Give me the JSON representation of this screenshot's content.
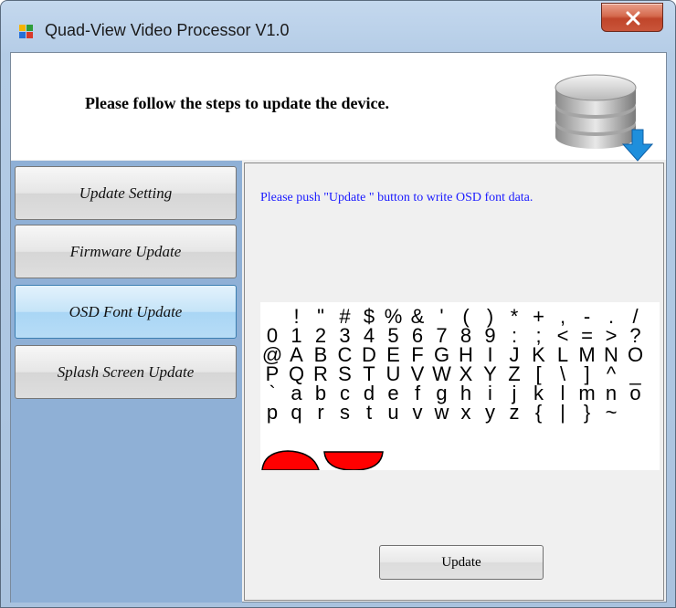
{
  "window": {
    "title": "Quad-View Video Processor V1.0"
  },
  "header": {
    "message": "Please follow the steps to update the device."
  },
  "sidebar": {
    "items": [
      {
        "label": "Update Setting",
        "active": false
      },
      {
        "label": "Firmware Update",
        "active": false
      },
      {
        "label": "OSD Font Update",
        "active": true
      },
      {
        "label": "Splash Screen Update",
        "active": false
      }
    ]
  },
  "content": {
    "instruction": "Please push \"Update \" button to write OSD font data.",
    "update_label": "Update",
    "font_rows": [
      [
        " ",
        "!",
        "\"",
        "#",
        "$",
        "%",
        "&",
        "'",
        "(",
        ")",
        "*",
        "+",
        ",",
        "-",
        ".",
        "/"
      ],
      [
        "0",
        "1",
        "2",
        "3",
        "4",
        "5",
        "6",
        "7",
        "8",
        "9",
        ":",
        ";",
        "<",
        "=",
        ">",
        "?"
      ],
      [
        "@",
        "A",
        "B",
        "C",
        "D",
        "E",
        "F",
        "G",
        "H",
        "I",
        "J",
        "K",
        "L",
        "M",
        "N",
        "O"
      ],
      [
        "P",
        "Q",
        "R",
        "S",
        "T",
        "U",
        "V",
        "W",
        "X",
        "Y",
        "Z",
        "[",
        "\\",
        "]",
        "^",
        "_"
      ],
      [
        "`",
        "a",
        "b",
        "c",
        "d",
        "e",
        "f",
        "g",
        "h",
        "i",
        "j",
        "k",
        "l",
        "m",
        "n",
        "o"
      ],
      [
        "p",
        "q",
        "r",
        "s",
        "t",
        "u",
        "v",
        "w",
        "x",
        "y",
        "z",
        "{",
        "|",
        "}",
        "~",
        ""
      ]
    ],
    "glyph_accent_color": "#ff0000"
  },
  "colors": {
    "sidebar_bg": "#8fb0d6",
    "active_button": "#b7dcf6",
    "instruction_text": "#1a1aff"
  }
}
